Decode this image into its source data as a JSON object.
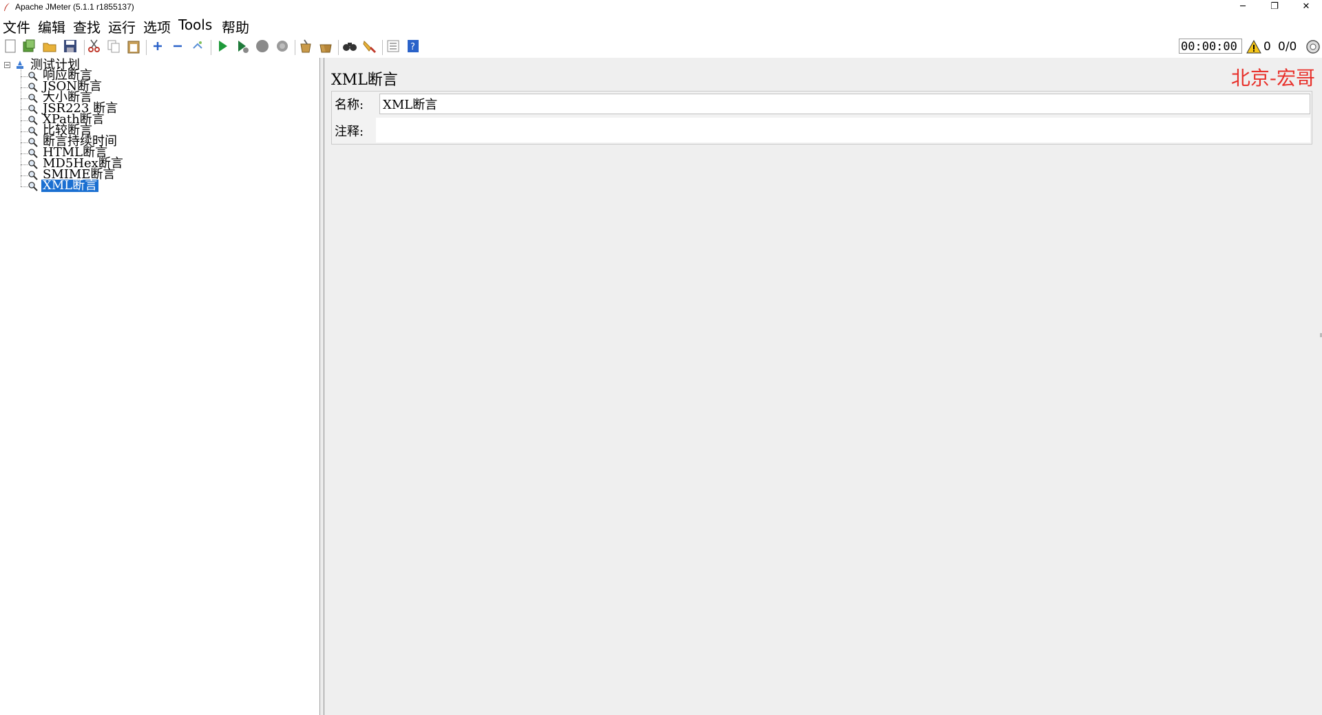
{
  "window": {
    "title": "Apache JMeter (5.1.1 r1855137)",
    "minimize": "─",
    "restore": "❐",
    "close": "✕"
  },
  "menu": [
    "文件",
    "编辑",
    "查找",
    "运行",
    "选项",
    "Tools",
    "帮助"
  ],
  "toolbar": {
    "icons": [
      "new-icon",
      "templates-icon",
      "open-icon",
      "save-icon",
      "cut-icon",
      "copy-icon",
      "paste-icon",
      "expand-icon",
      "collapse-icon",
      "toggle-icon",
      "start-icon",
      "start-no-pause-icon",
      "stop-icon",
      "shutdown-icon",
      "clear-icon",
      "clear-all-icon",
      "search-icon",
      "reset-search-icon",
      "function-helper-icon",
      "help-icon"
    ],
    "timer": "00:00:00",
    "warning_count": "0",
    "threads": "0/0"
  },
  "tree": {
    "root": "测试计划",
    "items": [
      "响应断言",
      "JSON断言",
      "大小断言",
      "JSR223 断言",
      "XPath断言",
      "比较断言",
      "断言持续时间",
      "HTML断言",
      "MD5Hex断言",
      "SMIME断言",
      "XML断言"
    ],
    "selected_index": 10
  },
  "panel": {
    "title": "XML断言",
    "watermark": "北京-宏哥",
    "name_label": "名称:",
    "name_value": "XML断言",
    "comment_label": "注释:",
    "comment_value": ""
  },
  "colors": {
    "selection": "#1a6fd1",
    "watermark": "#e8302a",
    "panel_bg": "#efefef"
  }
}
